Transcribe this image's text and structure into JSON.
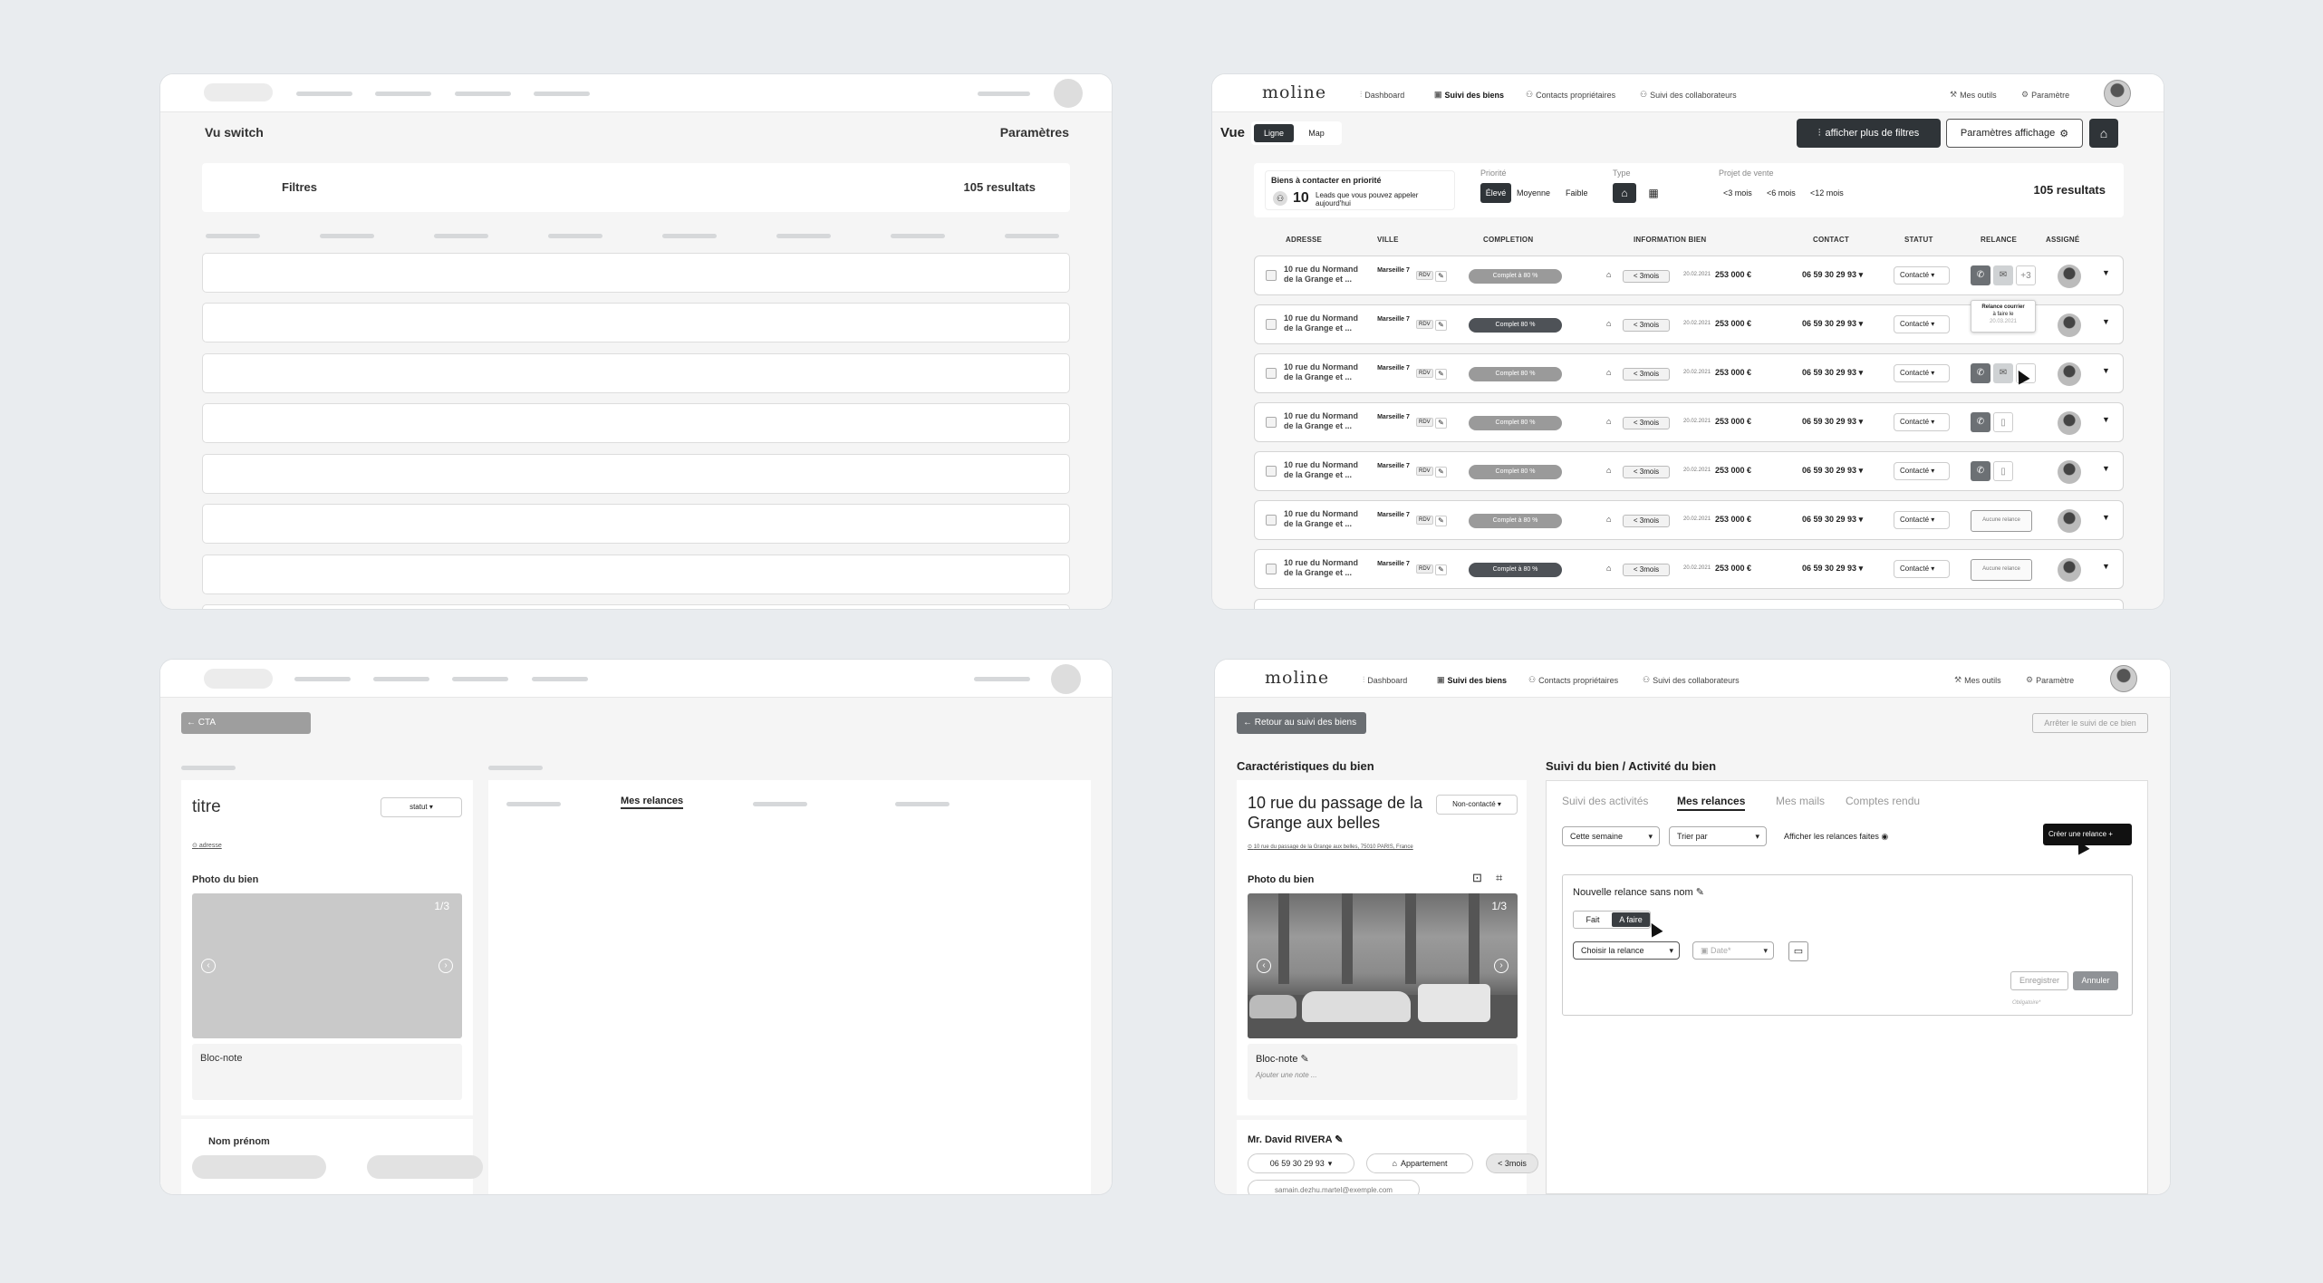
{
  "common": {
    "logo": "moline",
    "nav": [
      "Dashboard",
      "Suivi des biens",
      "Contacts propriétaires",
      "Suivi des collaborateurs"
    ],
    "nav_right": [
      "Mes outils",
      "Paramètre"
    ]
  },
  "panel1": {
    "title": "Vu switch",
    "settings": "Paramètres",
    "filters": "Filtres",
    "results": "105 resultats"
  },
  "panel2": {
    "vue_label": "Vue",
    "toggle": [
      "Ligne",
      "Map"
    ],
    "more_filters": "afficher plus de filtres",
    "display_settings": "Paramètres affichage",
    "priority_box": {
      "title": "Biens à contacter en priorité",
      "count": "10",
      "text": "Leads que vous pouvez appeler aujourd'hui"
    },
    "priority": {
      "label": "Priorité",
      "options": [
        "Élevé",
        "Moyenne",
        "Faible"
      ]
    },
    "type_label": "Type",
    "project": {
      "label": "Projet de vente",
      "options": [
        "<3 mois",
        "<6 mois",
        "<12 mois"
      ]
    },
    "results": "105 resultats",
    "columns": [
      "ADRESSE",
      "VILLE",
      "COMPLETION",
      "INFORMATION BIEN",
      "CONTACT",
      "STATUT",
      "RELANCE",
      "ASSIGNÉ"
    ],
    "rows": [
      {
        "address": "10 rue du Normand de la Grange et ...",
        "city": "Marseille 7",
        "tag": "RDV",
        "completion": "Complet à 80 %",
        "dark": false,
        "lt": "< 3mois",
        "date": "20.02.2021",
        "price": "253 000 €",
        "phone": "06 59 30 29 93",
        "status": "Contacté",
        "relance": "three",
        "extra": "+3"
      },
      {
        "address": "10 rue du Normand de la Grange et ...",
        "city": "Marseille 7",
        "tag": "RDV",
        "completion": "Complet 80 %",
        "dark": true,
        "lt": "< 3mois",
        "date": "20.02.2021",
        "price": "253 000 €",
        "phone": "06 59 30 29 93",
        "status": "Contacté",
        "relance": "tooltip",
        "extra": ""
      },
      {
        "address": "10 rue du Normand de la Grange et ...",
        "city": "Marseille 7",
        "tag": "RDV",
        "completion": "Complet 80 %",
        "dark": false,
        "lt": "< 3mois",
        "date": "20.02.2021",
        "price": "253 000 €",
        "phone": "06 59 30 29 93",
        "status": "Contacté",
        "relance": "three",
        "extra": ""
      },
      {
        "address": "10 rue du Normand de la Grange et ...",
        "city": "Marseille 7",
        "tag": "RDV",
        "completion": "Complet 80 %",
        "dark": false,
        "lt": "< 3mois",
        "date": "20.02.2021",
        "price": "253 000 €",
        "phone": "06 59 30 29 93",
        "status": "Contacté",
        "relance": "two",
        "extra": ""
      },
      {
        "address": "10 rue du Normand de la Grange et ...",
        "city": "Marseille 7",
        "tag": "RDV",
        "completion": "Complet 80 %",
        "dark": false,
        "lt": "< 3mois",
        "date": "20.02.2021",
        "price": "253 000 €",
        "phone": "06 59 30 29 93",
        "status": "Contacté",
        "relance": "two",
        "extra": ""
      },
      {
        "address": "10 rue du Normand de la Grange et ...",
        "city": "Marseille 7",
        "tag": "RDV",
        "completion": "Complet à 80 %",
        "dark": false,
        "lt": "< 3mois",
        "date": "20.02.2021",
        "price": "253 000 €",
        "phone": "06 59 30 29 93",
        "status": "Contacté",
        "relance": "none",
        "extra": "Aucune relance"
      },
      {
        "address": "10 rue du Normand de la Grange et ...",
        "city": "Marseille 7",
        "tag": "RDV",
        "completion": "Complet à 80 %",
        "dark": true,
        "lt": "< 3mois",
        "date": "20.02.2021",
        "price": "253 000 €",
        "phone": "06 59 30 29 93",
        "status": "Contacté",
        "relance": "none",
        "extra": "Aucune relance"
      }
    ],
    "tooltip": {
      "line1": "Relance courrier",
      "line2": "à faire le",
      "date": "20.03.2021"
    }
  },
  "panel3": {
    "cta": "CTA",
    "title": "titre",
    "status": "statut",
    "address": "adresse",
    "photo": "Photo du bien",
    "counter": "1/3",
    "note": "Bloc-note",
    "name": "Nom prénom",
    "tab": "Mes relances"
  },
  "panel4": {
    "back": "Retour au suivi des biens",
    "stop": "Arrêter le suivi de ce bien",
    "char_title": "Caractéristiques du bien",
    "activity_title": "Suivi du bien / Activité du bien",
    "property_title": "10 rue du passage de la Grange aux belles",
    "status": "Non-contacté",
    "address": "10 rue du passage de la Grange aux belles, 75010 PARIS, France",
    "photo": "Photo du bien",
    "counter": "1/3",
    "note_title": "Bloc-note",
    "note_placeholder": "Ajouter une note ...",
    "owner": "Mr. David RIVERA",
    "phone": "06 59 30 29 93",
    "type": "Appartement",
    "delay": "< 3mois",
    "email": "samain.dezhu.martel@exemple.com",
    "tabs": [
      "Suivi des activités",
      "Mes relances",
      "Mes mails",
      "Comptes rendu"
    ],
    "week": "Cette semaine",
    "sort": "Trier par",
    "show_done": "Afficher les relances faites",
    "create": "Créer une relance",
    "new_title": "Nouvelle relance sans nom",
    "fait": "Fait",
    "afaire": "A faire",
    "choose": "Choisir la relance",
    "date": "Date*",
    "save": "Enregistrer",
    "cancel": "Annuler",
    "required": "Obligatoire*"
  }
}
